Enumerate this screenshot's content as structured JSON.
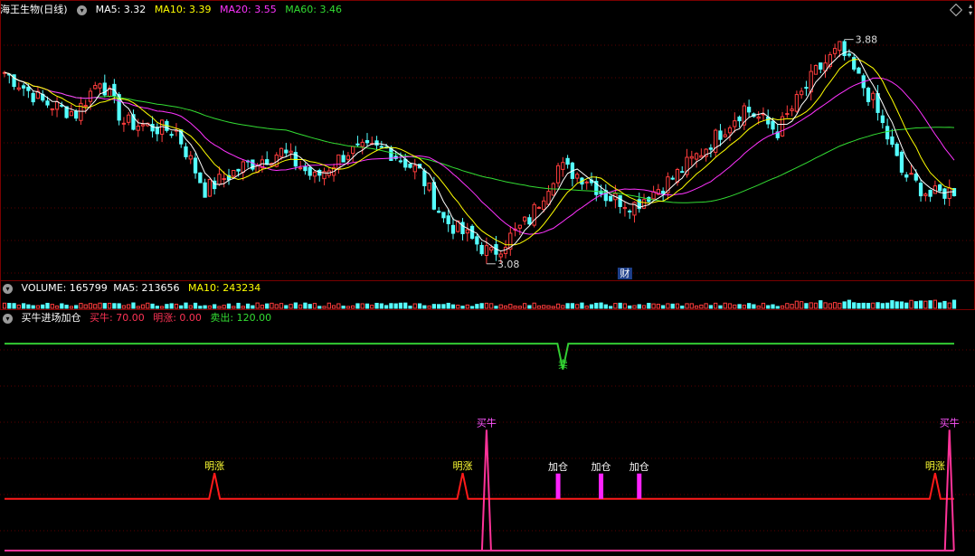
{
  "price_panel": {
    "title": "海王生物(日线)",
    "ma5": "MA5: 3.32",
    "ma10": "MA10: 3.39",
    "ma20": "MA20: 3.55",
    "ma60": "MA60: 3.46",
    "high_label": "3.88",
    "low_label": "3.08",
    "event_label": "财",
    "colors": {
      "up": "#ff3d3d",
      "down": "#54ffff",
      "ma5": "#ffffff",
      "ma10": "#ffff00",
      "ma20": "#ff33ff",
      "ma60": "#33dd33"
    }
  },
  "volume_panel": {
    "volume": "VOLUME: 165799",
    "ma5": "MA5: 213656",
    "ma10": "MA10: 243234"
  },
  "indicator_panel": {
    "name": "买牛进场加仓",
    "buy": "买牛: 70.00",
    "rise": "明涨: 0.00",
    "sell": "卖出: 120.00",
    "labels": {
      "rise": "明涨",
      "buy": "买牛",
      "add": "加仓",
      "sell": "卖"
    }
  },
  "chart_data": {
    "type": "line",
    "count": 200,
    "price_ylim": [
      3.08,
      3.88
    ],
    "high": 3.88,
    "low": 3.08,
    "key_points": [
      [
        0,
        3.72
      ],
      [
        8,
        3.62
      ],
      [
        15,
        3.58
      ],
      [
        20,
        3.7
      ],
      [
        25,
        3.55
      ],
      [
        36,
        3.52
      ],
      [
        42,
        3.32
      ],
      [
        50,
        3.4
      ],
      [
        58,
        3.45
      ],
      [
        65,
        3.36
      ],
      [
        72,
        3.45
      ],
      [
        80,
        3.46
      ],
      [
        87,
        3.38
      ],
      [
        92,
        3.22
      ],
      [
        98,
        3.15
      ],
      [
        102,
        3.1
      ],
      [
        110,
        3.22
      ],
      [
        116,
        3.4
      ],
      [
        122,
        3.36
      ],
      [
        126,
        3.3
      ],
      [
        132,
        3.27
      ],
      [
        140,
        3.36
      ],
      [
        146,
        3.45
      ],
      [
        155,
        3.6
      ],
      [
        162,
        3.52
      ],
      [
        170,
        3.72
      ],
      [
        175,
        3.8
      ],
      [
        182,
        3.62
      ],
      [
        188,
        3.38
      ],
      [
        194,
        3.3
      ],
      [
        199,
        3.32
      ]
    ],
    "ma_final": {
      "ma5": 3.32,
      "ma10": 3.39,
      "ma20": 3.55,
      "ma60": 3.46
    },
    "indicator": {
      "ylim": [
        0,
        130
      ],
      "baseline": 30,
      "sell_line": 120,
      "sell_dip_index": 117,
      "rise_spikes": [
        44,
        96,
        195
      ],
      "buy_spikes": [
        101,
        198
      ],
      "add_bars": [
        116,
        125,
        133
      ]
    }
  }
}
